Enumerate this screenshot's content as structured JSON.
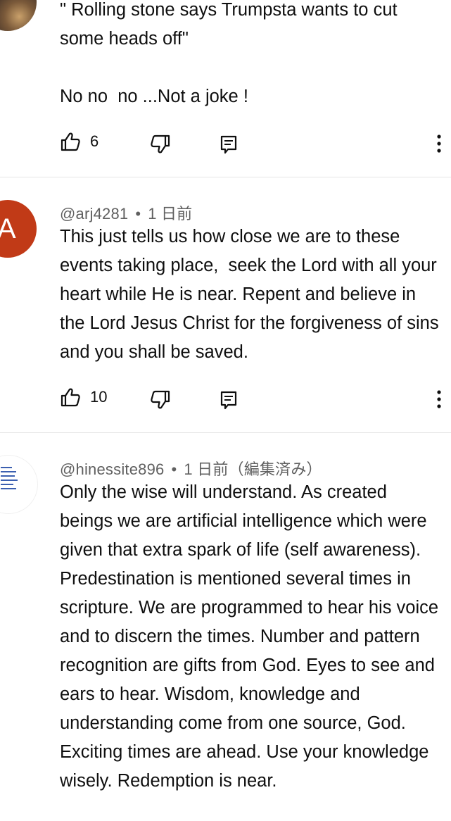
{
  "comments": [
    {
      "text": "\" Rolling stone says Trumpsta wants to cut some heads off\"\n\nNo no  no ...Not a joke !",
      "likes": "6"
    },
    {
      "avatar_letter": "A",
      "author": "@arj4281",
      "separator": "•",
      "time": "1 日前",
      "text": "This just tells us how close we are to these events taking place,  seek the Lord with all your heart while He is near. Repent and believe in the Lord Jesus Christ for the forgiveness of sins and you shall be saved.",
      "likes": "10"
    },
    {
      "author": "@hinessite896",
      "separator": "•",
      "time": "1 日前（編集済み）",
      "text": "Only the wise will understand. As created beings we are artificial intelligence which were given that extra spark of life (self awareness). Predestination is mentioned several times in scripture. We are programmed to hear his voice and to discern the times. Number and pattern recognition are gifts from God. Eyes to see and ears to hear. Wisdom, knowledge and understanding come from one source, God. Exciting times are ahead. Use your knowledge wisely. Redemption is near."
    }
  ],
  "icons": {
    "like": "thumb-up-icon",
    "dislike": "thumb-down-icon",
    "reply": "reply-icon",
    "more": "more-vert-icon"
  },
  "colors": {
    "avatar_a": "#c13a17",
    "meta_text": "#606060",
    "body_text": "#0f0f0f",
    "divider": "#e5e5e5"
  }
}
